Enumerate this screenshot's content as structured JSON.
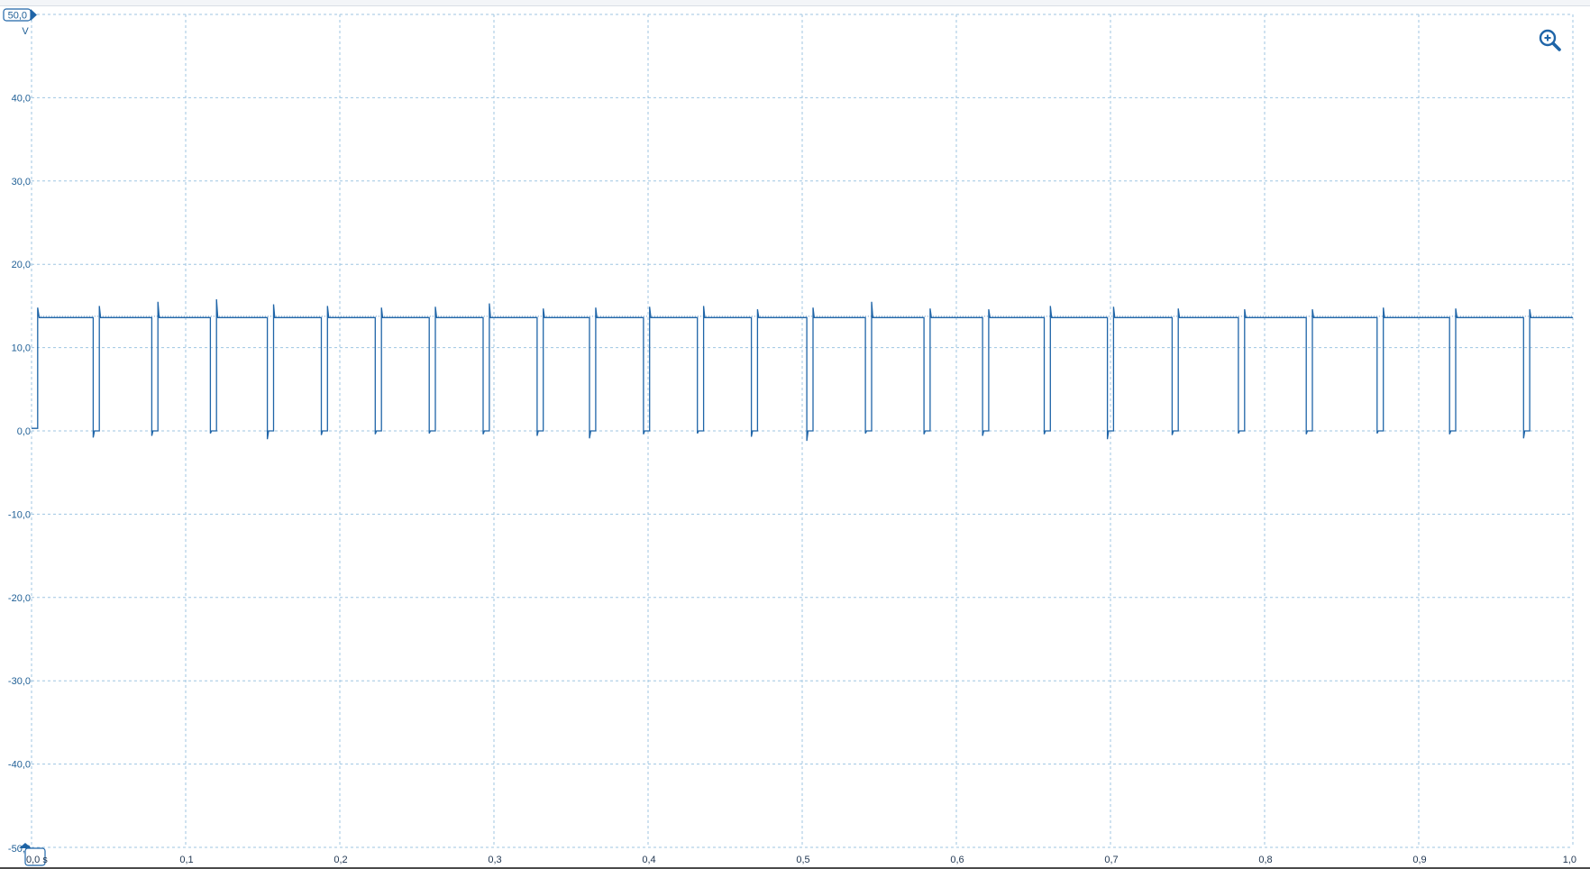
{
  "chart_data": {
    "type": "line",
    "title": "",
    "xlabel": "",
    "ylabel": "",
    "y_unit": "V",
    "x_unit_label": "0,0 s",
    "y_max_marker": "50,0",
    "y_min_marker": "-50,0",
    "xlim": [
      0.0,
      1.0
    ],
    "ylim": [
      -50.0,
      50.0
    ],
    "x_ticks": [
      0.0,
      0.1,
      0.2,
      0.3,
      0.4,
      0.5,
      0.6,
      0.7,
      0.8,
      0.9,
      1.0
    ],
    "x_tick_labels": [
      "",
      "0,1",
      "0,2",
      "0,3",
      "0,4",
      "0,5",
      "0,6",
      "0,7",
      "0,8",
      "0,9",
      "1,0"
    ],
    "y_ticks": [
      40,
      30,
      20,
      10,
      0,
      -10,
      -20,
      -30,
      -40
    ],
    "y_tick_labels": [
      "40,0",
      "30,0",
      "20,0",
      "10,0",
      "0,0",
      "-10,0",
      "-20,0",
      "-30,0",
      "-40,0"
    ],
    "grid": true,
    "legend": "none",
    "series": [
      {
        "color": "#1f65a8",
        "high_level_v": 13.6,
        "low_level_v": 0.0,
        "start_level_v": 0.3,
        "first_rise_s": 0.004,
        "low_intervals_s": [
          [
            0.04,
            0.044
          ],
          [
            0.078,
            0.082
          ],
          [
            0.116,
            0.12
          ],
          [
            0.153,
            0.157
          ],
          [
            0.188,
            0.192
          ],
          [
            0.223,
            0.227
          ],
          [
            0.258,
            0.262
          ],
          [
            0.293,
            0.297
          ],
          [
            0.328,
            0.332
          ],
          [
            0.362,
            0.366
          ],
          [
            0.397,
            0.401
          ],
          [
            0.432,
            0.436
          ],
          [
            0.467,
            0.471
          ],
          [
            0.503,
            0.507
          ],
          [
            0.541,
            0.545
          ],
          [
            0.579,
            0.583
          ],
          [
            0.617,
            0.621
          ],
          [
            0.657,
            0.661
          ],
          [
            0.698,
            0.702
          ],
          [
            0.74,
            0.744
          ],
          [
            0.783,
            0.787
          ],
          [
            0.827,
            0.831
          ],
          [
            0.873,
            0.877
          ],
          [
            0.92,
            0.924
          ],
          [
            0.968,
            0.972
          ]
        ],
        "rising_spikes_v": [
          15.0,
          15.5,
          15.8,
          15.2,
          15.0,
          14.8,
          14.9,
          15.3,
          14.7,
          14.8,
          14.9,
          15.0,
          14.6,
          14.8,
          15.5,
          14.7,
          14.6,
          15.0,
          14.9,
          14.7,
          14.6,
          14.6,
          14.8,
          14.7,
          14.6
        ],
        "falling_dips_v": [
          -0.8,
          -0.6,
          -0.3,
          -1.0,
          -0.5,
          -0.4,
          -0.3,
          -0.4,
          -0.6,
          -0.9,
          -0.4,
          -0.3,
          -0.7,
          -1.2,
          -0.3,
          -0.4,
          -0.6,
          -0.4,
          -1.0,
          -0.5,
          -0.3,
          -0.4,
          -0.3,
          -0.4,
          -0.9
        ]
      }
    ]
  },
  "zoom_icon": "zoom-in-icon"
}
